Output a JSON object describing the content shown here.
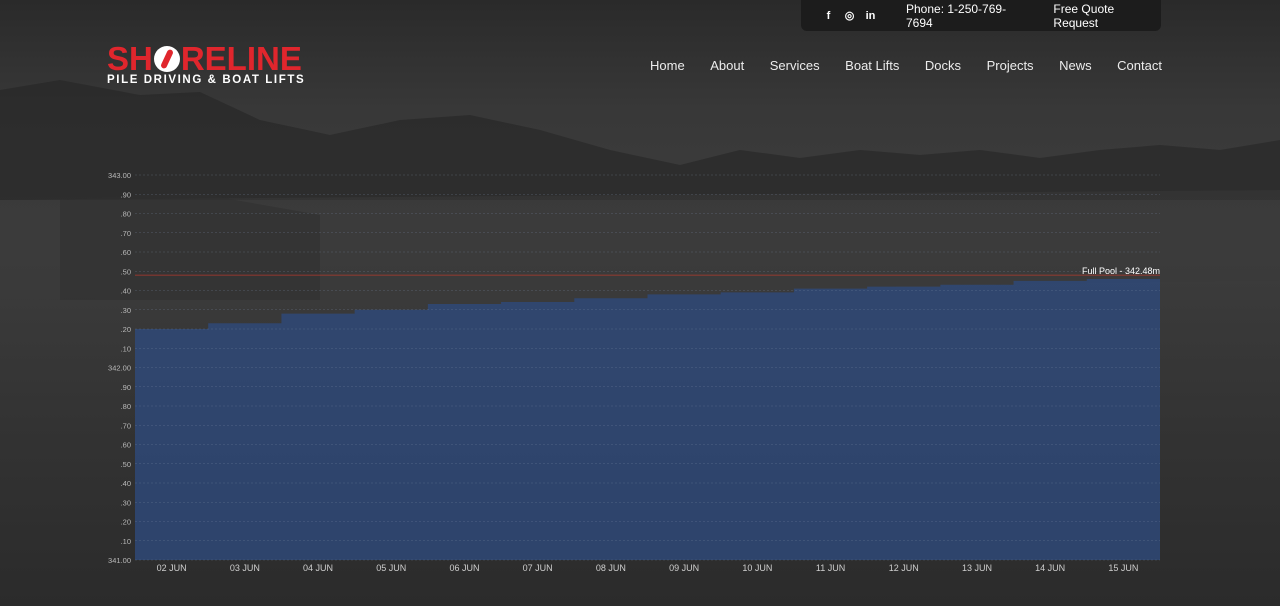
{
  "header": {
    "social_icons": [
      "facebook-icon",
      "instagram-icon",
      "linkedin-icon"
    ],
    "social_glyphs": [
      "f",
      "◎",
      "in"
    ],
    "phone": "Phone: 1-250-769-7694",
    "quote_link": "Free Quote Request"
  },
  "logo": {
    "wordmark_left": "SH",
    "wordmark_right": "RELINE",
    "tagline": "PILE DRIVING & BOAT LIFTS"
  },
  "nav": {
    "items": [
      "Home",
      "About",
      "Services",
      "Boat Lifts",
      "Docks",
      "Projects",
      "News",
      "Contact"
    ]
  },
  "colors": {
    "brand_red": "#e0262d",
    "area_fill": "#2e4a7e",
    "full_pool_line": "#c0392b"
  },
  "chart_data": {
    "type": "area",
    "title": "",
    "xlabel": "",
    "ylabel": "",
    "ylim": [
      341.0,
      343.0
    ],
    "yticks": [
      "343.00",
      ".90",
      ".80",
      ".70",
      ".60",
      ".50",
      ".40",
      ".30",
      ".20",
      ".10",
      "342.00",
      ".90",
      ".80",
      ".70",
      ".60",
      ".50",
      ".40",
      ".30",
      ".20",
      ".10",
      "341.00"
    ],
    "categories": [
      "02 JUN",
      "03 JUN",
      "04 JUN",
      "05 JUN",
      "06 JUN",
      "07 JUN",
      "08 JUN",
      "09 JUN",
      "10 JUN",
      "11 JUN",
      "12 JUN",
      "13 JUN",
      "14 JUN",
      "15 JUN"
    ],
    "series": [
      {
        "values": [
          342.2,
          342.23,
          342.28,
          342.3,
          342.33,
          342.34,
          342.36,
          342.38,
          342.39,
          342.41,
          342.42,
          342.43,
          342.45,
          342.46
        ]
      }
    ],
    "reference_line": {
      "label": "Full Pool - 342.48m",
      "value": 342.48
    },
    "grid": true
  }
}
